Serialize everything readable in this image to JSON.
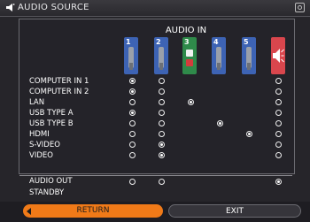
{
  "window": {
    "title": "AUDIO SOURCE",
    "title_icon": "speaker-icon",
    "corner_icon": "settings-icon"
  },
  "header": {
    "audio_in_label": "AUDIO IN"
  },
  "ports": [
    {
      "number": "1",
      "color": "#3d63b4",
      "icon": "audio-jack-icon"
    },
    {
      "number": "2",
      "color": "#3d63b4",
      "icon": "audio-jack-icon"
    },
    {
      "number": "3",
      "color": "#2f8a4a",
      "icon": "rca-white-icon"
    },
    {
      "number": "4",
      "color": "#3d63b4",
      "icon": "audio-jack-icon"
    },
    {
      "number": "5",
      "color": "#3d63b4",
      "icon": "audio-jack-icon"
    },
    {
      "number": "",
      "color": "#d9464d",
      "icon": "speaker-mute-icon"
    }
  ],
  "rows": [
    {
      "label": "COMPUTER IN 1",
      "cells": [
        "on",
        "off",
        "",
        "",
        "",
        "off"
      ]
    },
    {
      "label": "COMPUTER IN 2",
      "cells": [
        "on",
        "off",
        "",
        "",
        "",
        "off"
      ]
    },
    {
      "label": "LAN",
      "cells": [
        "off",
        "off",
        "on",
        "",
        "",
        "off"
      ]
    },
    {
      "label": "USB TYPE A",
      "cells": [
        "on",
        "off",
        "",
        "",
        "",
        "off"
      ]
    },
    {
      "label": "USB TYPE B",
      "cells": [
        "off",
        "off",
        "",
        "on",
        "",
        "off"
      ]
    },
    {
      "label": "HDMI",
      "cells": [
        "off",
        "off",
        "",
        "",
        "on",
        "off"
      ]
    },
    {
      "label": "S-VIDEO",
      "cells": [
        "off",
        "on",
        "",
        "",
        "",
        "off"
      ]
    },
    {
      "label": "VIDEO",
      "cells": [
        "off",
        "on",
        "",
        "",
        "",
        "off"
      ]
    }
  ],
  "audio_out": {
    "label": "AUDIO OUT",
    "cells": [
      "off",
      "off",
      "",
      "",
      "",
      "on"
    ]
  },
  "standby": {
    "label": "STANDBY"
  },
  "footer": {
    "return_label": "RETURN",
    "exit_label": "EXIT"
  }
}
